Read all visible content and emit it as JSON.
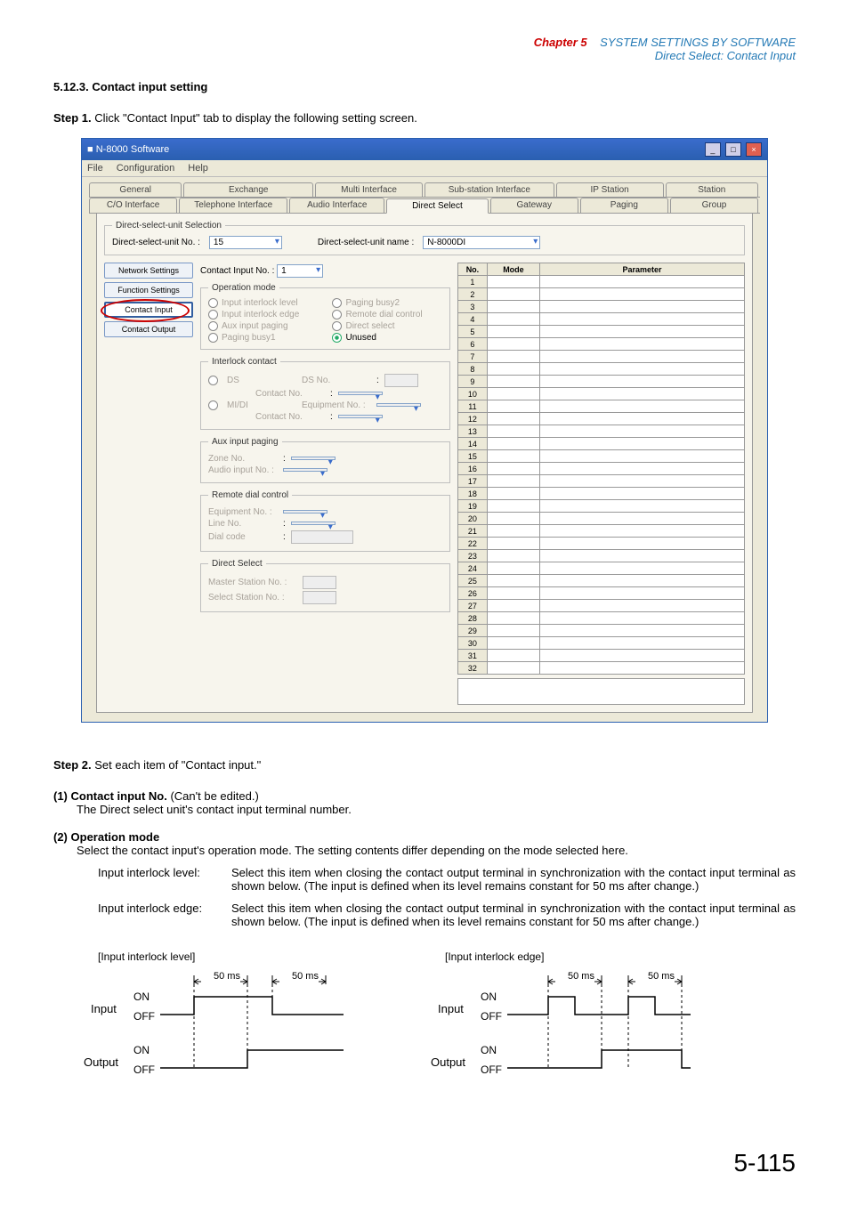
{
  "header": {
    "chapter_label": "Chapter 5",
    "chapter_title": "SYSTEM SETTINGS BY SOFTWARE",
    "subtitle": "Direct Select: Contact Input"
  },
  "section_heading": "5.12.3. Contact input setting",
  "step1": {
    "label": "Step 1.",
    "text": "Click \"Contact Input\" tab to display the following setting screen."
  },
  "win": {
    "title_icon": "■",
    "title": "N-8000 Software",
    "menu": {
      "file": "File",
      "config": "Configuration",
      "help": "Help"
    },
    "tabs_row1": {
      "general": "General",
      "exchange": "Exchange",
      "multi": "Multi Interface",
      "substation": "Sub-station Interface",
      "ipstation": "IP Station",
      "station": "Station"
    },
    "tabs_row2": {
      "co": "C/O Interface",
      "telephone": "Telephone Interface",
      "audio": "Audio Interface",
      "direct": "Direct Select",
      "gateway": "Gateway",
      "paging": "Paging",
      "group": "Group"
    },
    "ds_selection": {
      "legend": "Direct-select-unit Selection",
      "unit_no_label": "Direct-select-unit No. :",
      "unit_no": "15",
      "unit_name_label": "Direct-select-unit name :",
      "unit_name": "N-8000DI"
    },
    "sidebar": {
      "network": "Network Settings",
      "function": "Function Settings",
      "contact_input": "Contact Input",
      "contact_output": "Contact Output"
    },
    "center": {
      "contact_input_no_label": "Contact Input No. :",
      "contact_input_no": "1",
      "operation_mode_legend": "Operation mode",
      "op": {
        "input_level": "Input interlock level",
        "paging_busy2": "Paging busy2",
        "input_edge": "Input interlock edge",
        "remote_dial": "Remote dial control",
        "aux_paging": "Aux input paging",
        "direct_select": "Direct select",
        "paging_busy1": "Paging busy1",
        "unused": "Unused"
      },
      "interlock_legend": "Interlock contact",
      "interlock": {
        "ds": "DS",
        "ds_no": "DS No.",
        "contact_no": "Contact No.",
        "midi": "MI/DI",
        "equip_no": "Equipment No. :"
      },
      "aux_legend": "Aux input paging",
      "aux": {
        "zone": "Zone No.",
        "audio": "Audio input No. :"
      },
      "remote_legend": "Remote dial control",
      "remote": {
        "equip": "Equipment No. :",
        "line": "Line No.",
        "dial": "Dial code"
      },
      "ds_legend": "Direct Select",
      "ds_fields": {
        "master": "Master Station No. :",
        "select": "Select Station No.  :"
      }
    },
    "table": {
      "h_no": "No.",
      "h_mode": "Mode",
      "h_param": "Parameter",
      "rows": 32
    }
  },
  "step2": {
    "label": "Step 2.",
    "text": "Set each item of \"Contact input.\""
  },
  "item1": {
    "num": "(1)",
    "title": "Contact input No.",
    "note": "(Can't be edited.)",
    "body": "The Direct select unit's contact input terminal number."
  },
  "item2": {
    "num": "(2)",
    "title": "Operation mode",
    "body": "Select the contact input's operation mode. The setting contents differ depending on the mode selected here.",
    "r1_label": "Input interlock level:",
    "r1_body": "Select this item when closing the contact output terminal in synchronization with the contact input terminal as shown below. (The input is defined when its level remains constant for 50 ms after change.)",
    "r2_label": "Input interlock edge:",
    "r2_body": "Select this item when closing the contact output terminal in synchronization with the contact input terminal as shown below. (The input is defined when its level remains constant for 50 ms after change.)"
  },
  "diagrams": {
    "left_title": "[Input interlock level]",
    "right_title": "[Input interlock edge]",
    "input": "Input",
    "output": "Output",
    "on": "ON",
    "off": "OFF",
    "ms": "50 ms"
  },
  "page": "5-115"
}
